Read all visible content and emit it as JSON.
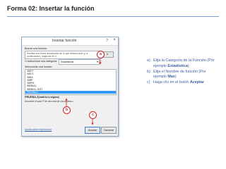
{
  "slide": {
    "title": "Forma 02: Insertar la función"
  },
  "dialog": {
    "title": "Insertar función",
    "help": "?",
    "close": "×",
    "search_label": "Buscar una función:",
    "search_value": "Escriba una breve descripción de lo que desea hacer y, a continuación, haga clic en Ir",
    "go_button": "Ir",
    "category_label": "O seleccionar una categoría:",
    "category_value": "Estadísticas",
    "function_list_label": "Seleccionar una función:",
    "functions": [
      "VAR.P",
      "VAR.S",
      "VARA",
      "VARP",
      "VARPA",
      "WEIBULL",
      "WEIBULL.DIST"
    ],
    "selected_function": "PRUEBA.Z",
    "function_signature": "PRUEBA.Z(matriz;x;sigma)",
    "function_description": "Devuelve el valor P de una cola de una prueba z.",
    "help_link": "Ayuda sobre esta función",
    "ok_button": "Aceptar",
    "cancel_button": "Cancelar"
  },
  "markers": {
    "a": "a",
    "b": "b",
    "c": "c"
  },
  "instructions": {
    "steps": [
      {
        "letter": "a)",
        "text": "Elija la Categoría de la Función (Por ejemplo ",
        "emph": "Estadística",
        "suffix": ")"
      },
      {
        "letter": "b)",
        "text": "Elija el Nombre de función (Por ejemplo ",
        "emph": "Max",
        "suffix": ")"
      },
      {
        "letter": "c)",
        "text": "Haga clic en el botón ",
        "emph": "Aceptar",
        "suffix": ""
      }
    ]
  },
  "colors": {
    "accent": "#3b5fa5",
    "marker": "#d02020",
    "selection": "#3399ff"
  }
}
